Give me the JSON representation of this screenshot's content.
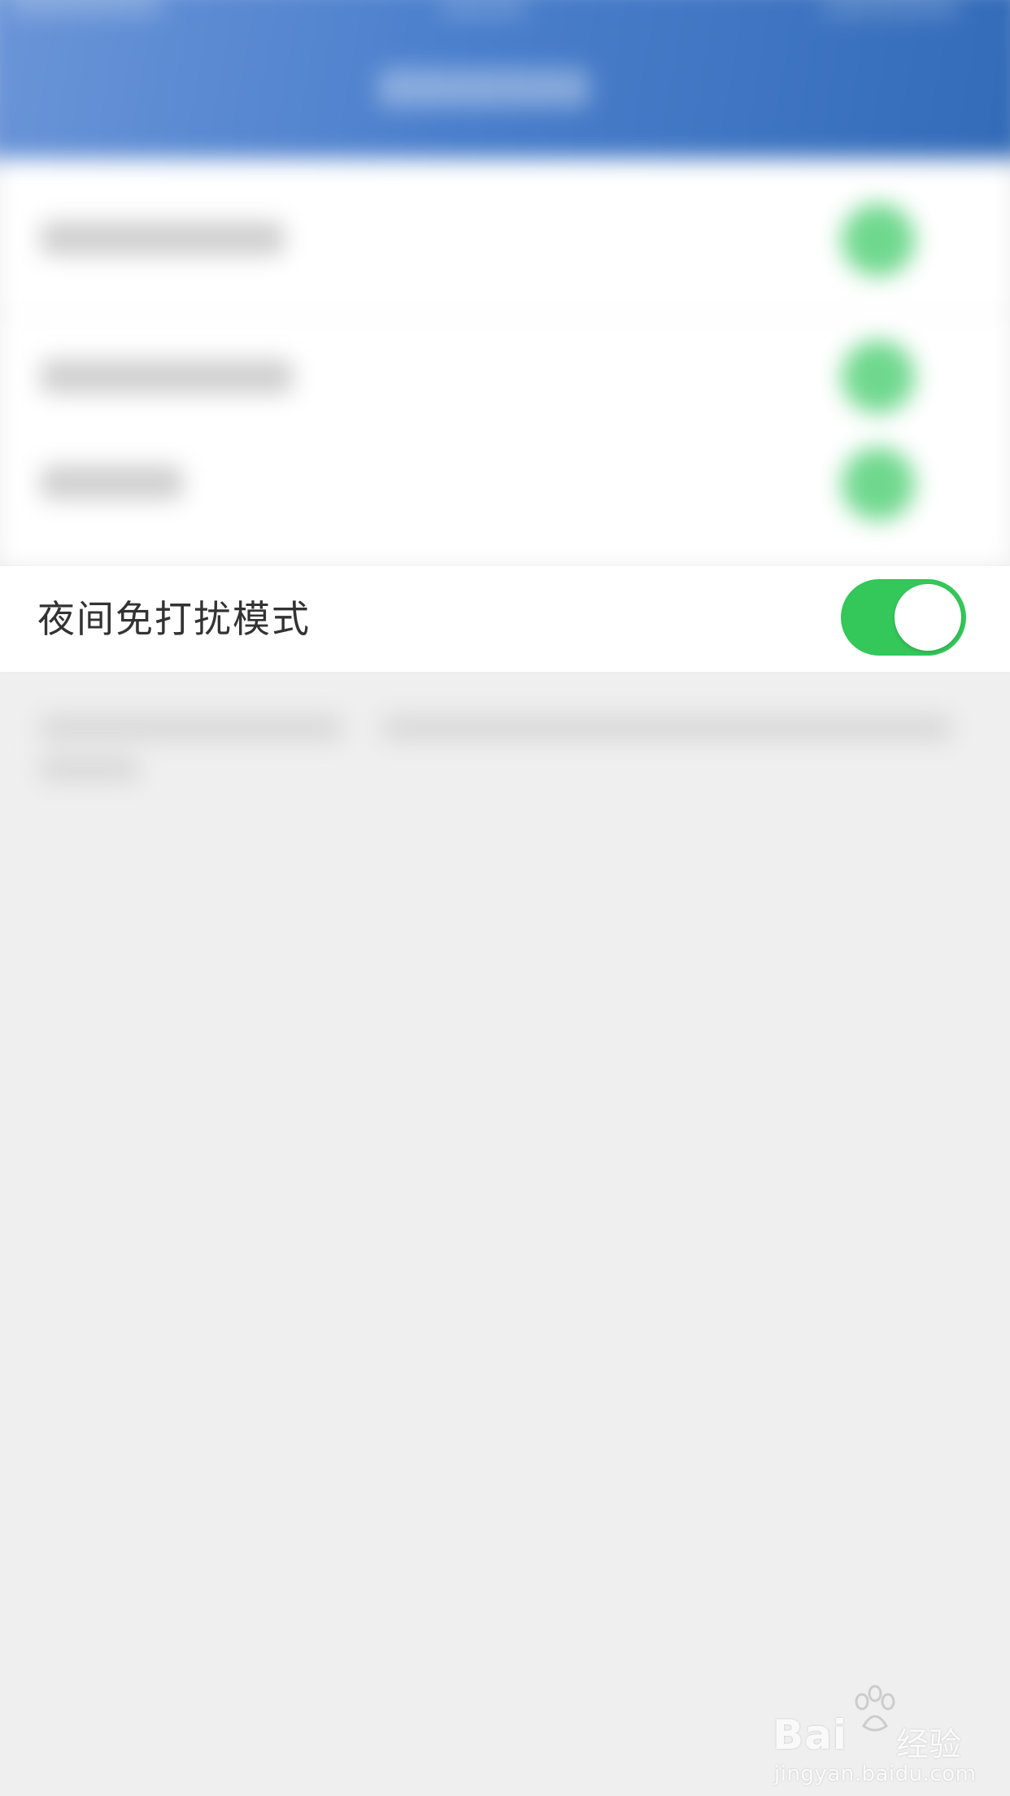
{
  "settings": {
    "night_dnd_label": "夜间免打扰模式",
    "night_dnd_enabled": true
  },
  "colors": {
    "nav_bar": "#4b7fcc",
    "toggle_on": "#34c759",
    "page_background": "#efefef"
  },
  "watermark": {
    "brand": "Bai",
    "brand_suffix": "经验",
    "url": "jingyan.baidu.com"
  }
}
